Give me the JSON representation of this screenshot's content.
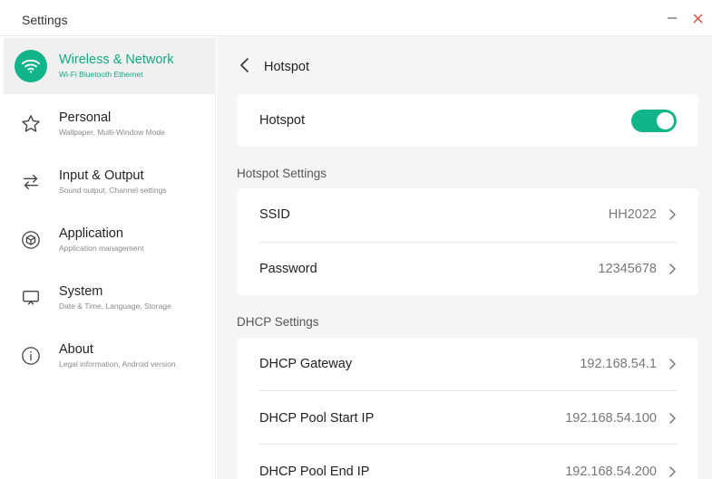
{
  "window": {
    "title": "Settings"
  },
  "sidebar": {
    "items": [
      {
        "label": "Wireless & Network",
        "sub": "Wi-Fi Bluetooth Ethernet",
        "icon": "wifi-icon",
        "active": true
      },
      {
        "label": "Personal",
        "sub": "Wallpaper, Multi-Window Mode",
        "icon": "star-icon",
        "active": false
      },
      {
        "label": "Input & Output",
        "sub": "Sound output, Channel settings",
        "icon": "swap-arrows-icon",
        "active": false
      },
      {
        "label": "Application",
        "sub": "Application management",
        "icon": "cube-icon",
        "active": false
      },
      {
        "label": "System",
        "sub": "Date & Time, Language, Storage",
        "icon": "monitor-icon",
        "active": false
      },
      {
        "label": "About",
        "sub": "Legal information, Android version",
        "icon": "info-icon",
        "active": false
      }
    ]
  },
  "main": {
    "title": "Hotspot",
    "hotspot": {
      "label": "Hotspot",
      "enabled": true
    },
    "hotspot_settings": {
      "title": "Hotspot Settings",
      "rows": [
        {
          "label": "SSID",
          "value": "HH2022"
        },
        {
          "label": "Password",
          "value": "12345678"
        }
      ]
    },
    "dhcp_settings": {
      "title": "DHCP Settings",
      "rows": [
        {
          "label": "DHCP Gateway",
          "value": "192.168.54.1"
        },
        {
          "label": "DHCP Pool Start IP",
          "value": "192.168.54.100"
        },
        {
          "label": "DHCP Pool End IP",
          "value": "192.168.54.200"
        }
      ]
    }
  },
  "colors": {
    "accent": "#12b48a",
    "close": "#e0483a",
    "background": "#f5f5f5"
  }
}
